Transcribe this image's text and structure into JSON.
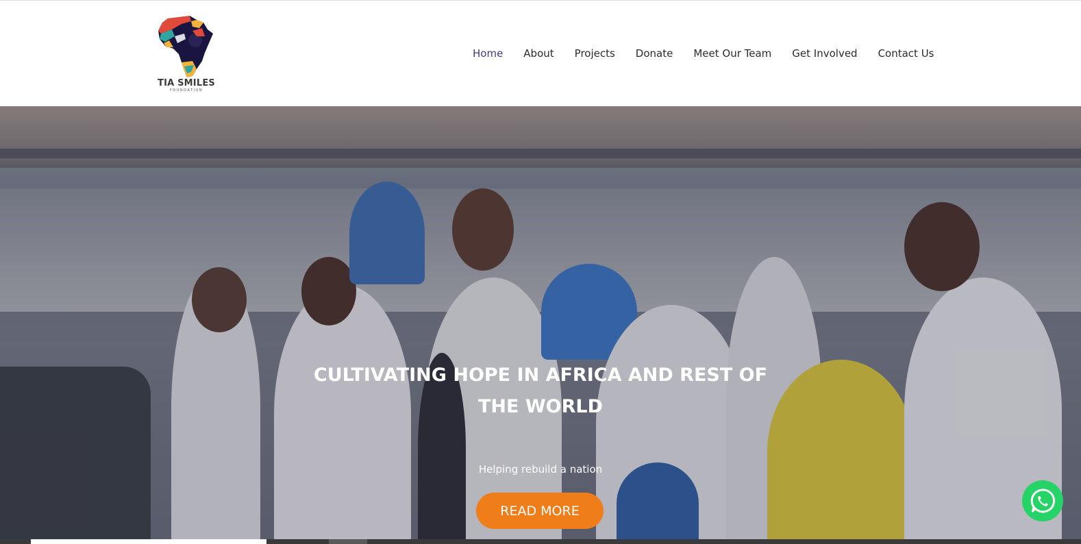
{
  "brand": {
    "name": "TIA SMILES",
    "subtitle": "FOUNDATION"
  },
  "nav": {
    "items": [
      {
        "label": "Home",
        "active": true
      },
      {
        "label": "About"
      },
      {
        "label": "Projects"
      },
      {
        "label": "Donate"
      },
      {
        "label": "Meet Our Team"
      },
      {
        "label": "Get Involved"
      },
      {
        "label": "Contact Us"
      }
    ]
  },
  "hero": {
    "title_line1": "CULTIVATING HOPE IN AFRICA AND REST OF",
    "title_line2": "THE WORLD",
    "subtitle": "Helping rebuild a nation",
    "cta_label": "READ MORE"
  },
  "colors": {
    "accent_orange": "#ee7d1a",
    "nav_active": "#3d3a8f",
    "whatsapp_green": "#25d366"
  },
  "icons": {
    "floating_button": "whatsapp-icon"
  }
}
